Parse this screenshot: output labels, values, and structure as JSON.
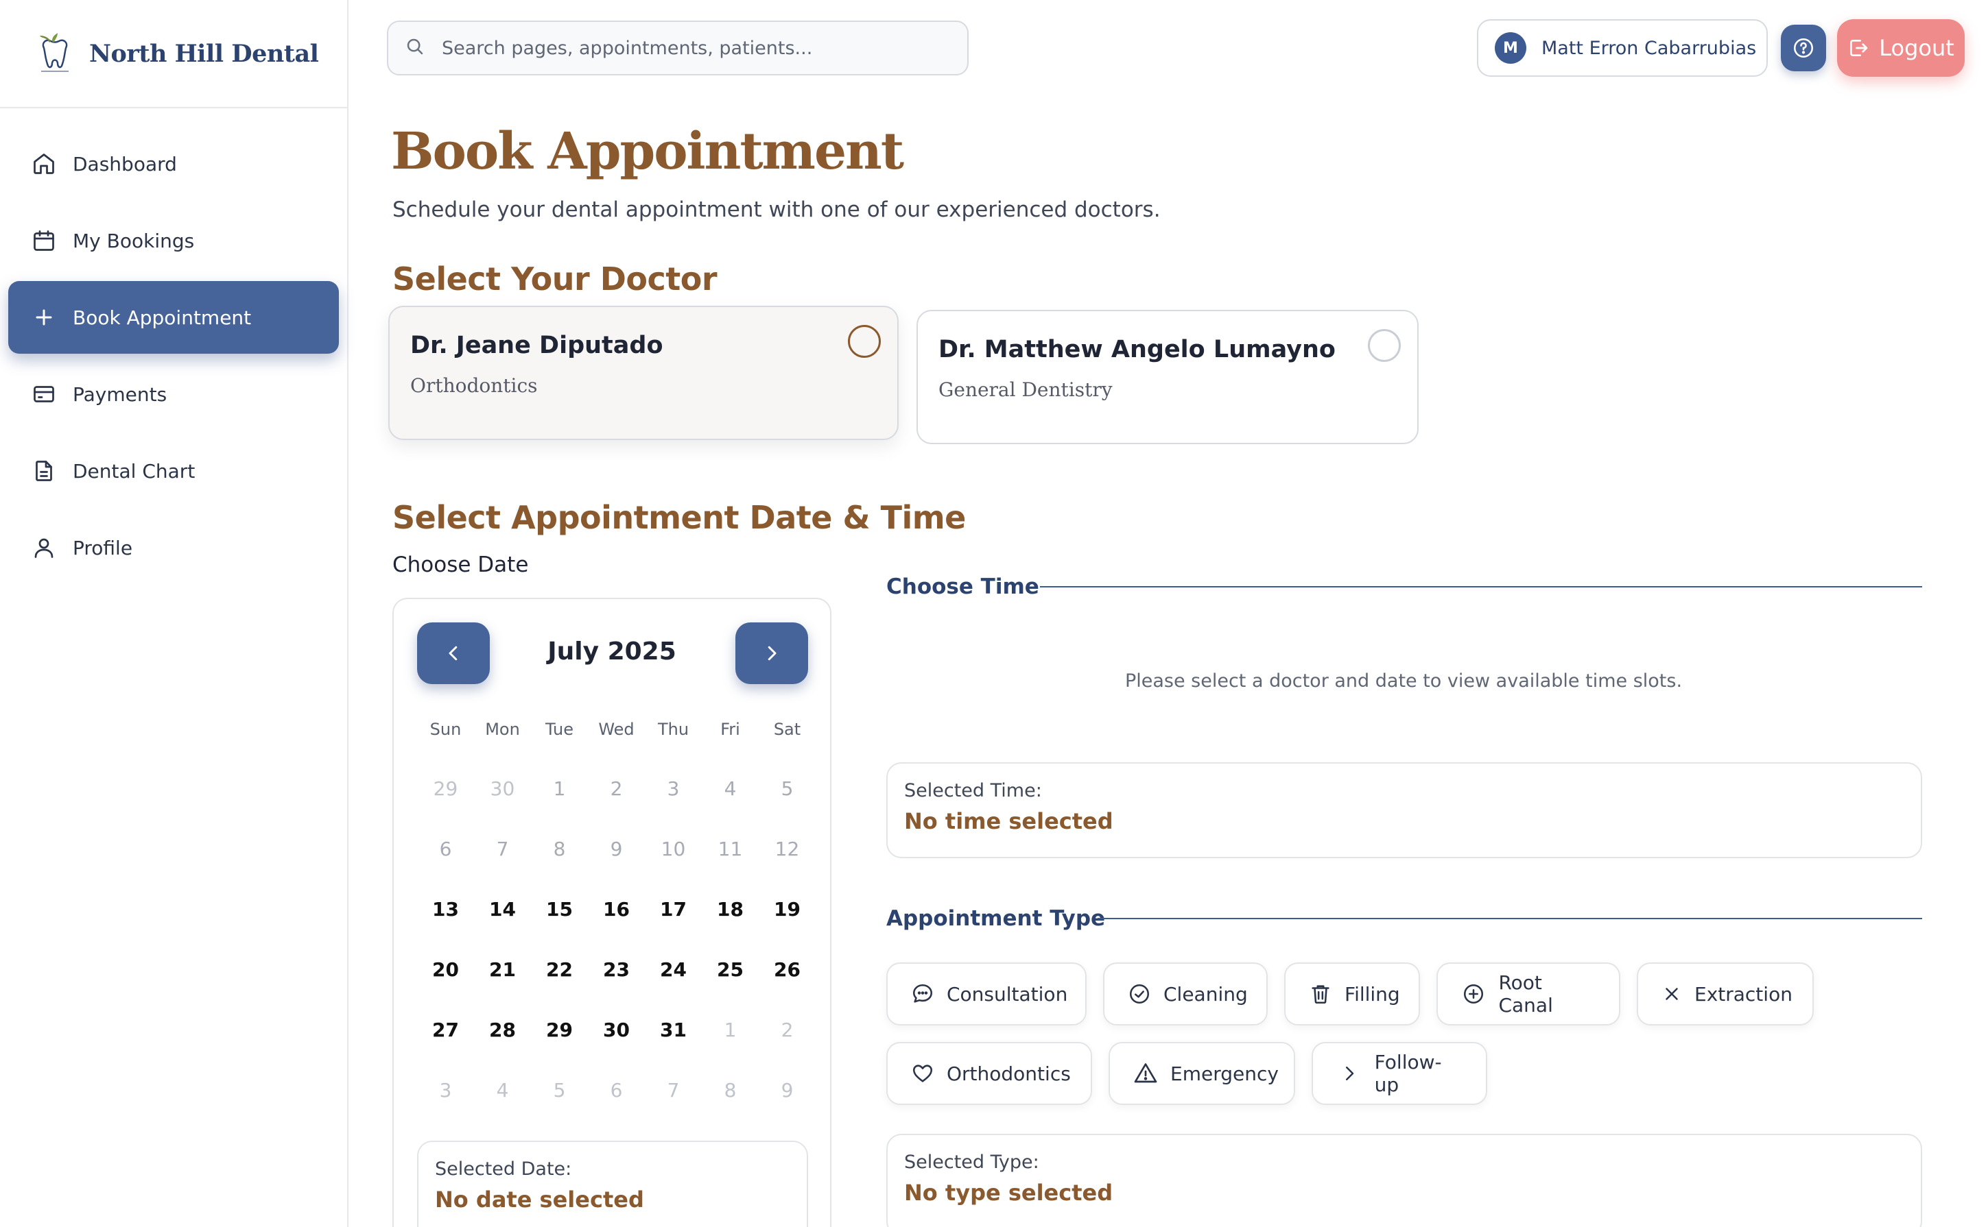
{
  "brand": {
    "name": "North Hill Dental"
  },
  "sidebar": {
    "items": [
      {
        "label": "Dashboard",
        "icon": "home-icon"
      },
      {
        "label": "My Bookings",
        "icon": "calendar-icon"
      },
      {
        "label": "Book Appointment",
        "icon": "plus-icon",
        "active": true
      },
      {
        "label": "Payments",
        "icon": "credit-card-icon"
      },
      {
        "label": "Dental Chart",
        "icon": "document-icon"
      },
      {
        "label": "Profile",
        "icon": "user-icon"
      }
    ]
  },
  "topbar": {
    "search_placeholder": "Search pages, appointments, patients...",
    "user_initial": "M",
    "user_name": "Matt Erron Cabarrubias",
    "logout_label": "Logout"
  },
  "page": {
    "title": "Book Appointment",
    "subtitle": "Schedule your dental appointment with one of our experienced doctors."
  },
  "doctors": {
    "heading": "Select Your Doctor",
    "list": [
      {
        "name": "Dr. Jeane Diputado",
        "specialty": "Orthodontics",
        "selected": true
      },
      {
        "name": "Dr. Matthew Angelo Lumayno",
        "specialty": "General Dentistry",
        "selected": false
      }
    ]
  },
  "schedule": {
    "heading": "Select Appointment Date & Time",
    "choose_date_label": "Choose Date",
    "calendar": {
      "month": "July 2025",
      "days_of_week": [
        "Sun",
        "Mon",
        "Tue",
        "Wed",
        "Thu",
        "Fri",
        "Sat"
      ],
      "weeks": [
        [
          "29",
          "30",
          "1",
          "2",
          "3",
          "4",
          "5"
        ],
        [
          "6",
          "7",
          "8",
          "9",
          "10",
          "11",
          "12"
        ],
        [
          "13",
          "14",
          "15",
          "16",
          "17",
          "18",
          "19"
        ],
        [
          "20",
          "21",
          "22",
          "23",
          "24",
          "25",
          "26"
        ],
        [
          "27",
          "28",
          "29",
          "30",
          "31",
          "1",
          "2"
        ],
        [
          "3",
          "4",
          "5",
          "6",
          "7",
          "8",
          "9"
        ]
      ]
    },
    "selected_date_label": "Selected Date:",
    "selected_date_value": "No date selected",
    "choose_time_label": "Choose Time",
    "time_empty_message": "Please select a doctor and date to view available time slots.",
    "selected_time_label": "Selected Time:",
    "selected_time_value": "No time selected"
  },
  "appointment_type": {
    "heading": "Appointment Type",
    "types": [
      {
        "label": "Consultation",
        "icon": "chat-bubble-icon"
      },
      {
        "label": "Cleaning",
        "icon": "check-circle-icon"
      },
      {
        "label": "Filling",
        "icon": "trash-icon"
      },
      {
        "label": "Root Canal",
        "icon": "plus-circle-icon"
      },
      {
        "label": "Extraction",
        "icon": "x-icon"
      },
      {
        "label": "Orthodontics",
        "icon": "heart-icon"
      },
      {
        "label": "Emergency",
        "icon": "warning-triangle-icon"
      },
      {
        "label": "Follow-up",
        "icon": "chevron-right-icon"
      }
    ],
    "selected_type_label": "Selected Type:",
    "selected_type_value": "No type selected"
  },
  "colors": {
    "primary": "#46639a",
    "brand_navy": "#2c4370",
    "accent_brown": "#8a5a2e",
    "logout": "#f08b8b"
  }
}
